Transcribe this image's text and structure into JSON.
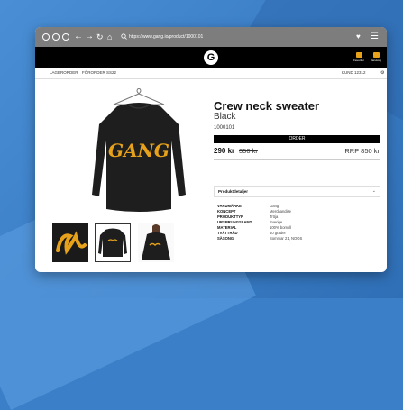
{
  "browser": {
    "url": "https://www.gang.io/product/1000101"
  },
  "header": {
    "logo_letter": "G",
    "favorites_label": "Favoriter",
    "cart_label": "Varukorg"
  },
  "subnav": {
    "items": [
      "LAGERORDER",
      "FÖRORDER SS22"
    ],
    "customer": "KUND 12312"
  },
  "product": {
    "title": "Crew neck sweater",
    "color": "Black",
    "sku": "1000101",
    "order_label": "ORDER",
    "price": "290 kr",
    "old_price": "350 kr",
    "rrp": "RRP 850 kr",
    "print_text": "GANG"
  },
  "details": {
    "heading": "Produktdetaljer",
    "rows": [
      {
        "key": "VARUMÄRKE",
        "value": "Gang"
      },
      {
        "key": "KONCEPT",
        "value": "Merchandise"
      },
      {
        "key": "PRODUKTTYP",
        "value": "Tröja"
      },
      {
        "key": "URSPRUNGSLAND",
        "value": "Sverige"
      },
      {
        "key": "MATERIAL",
        "value": "100% bomull"
      },
      {
        "key": "TVÄTTRÅD",
        "value": "40 grader"
      },
      {
        "key": "SÄSONG",
        "value": "Sommar 21, NOOS"
      }
    ]
  },
  "colors": {
    "accent": "#e8a21a",
    "chrome": "#7d7d7d"
  }
}
